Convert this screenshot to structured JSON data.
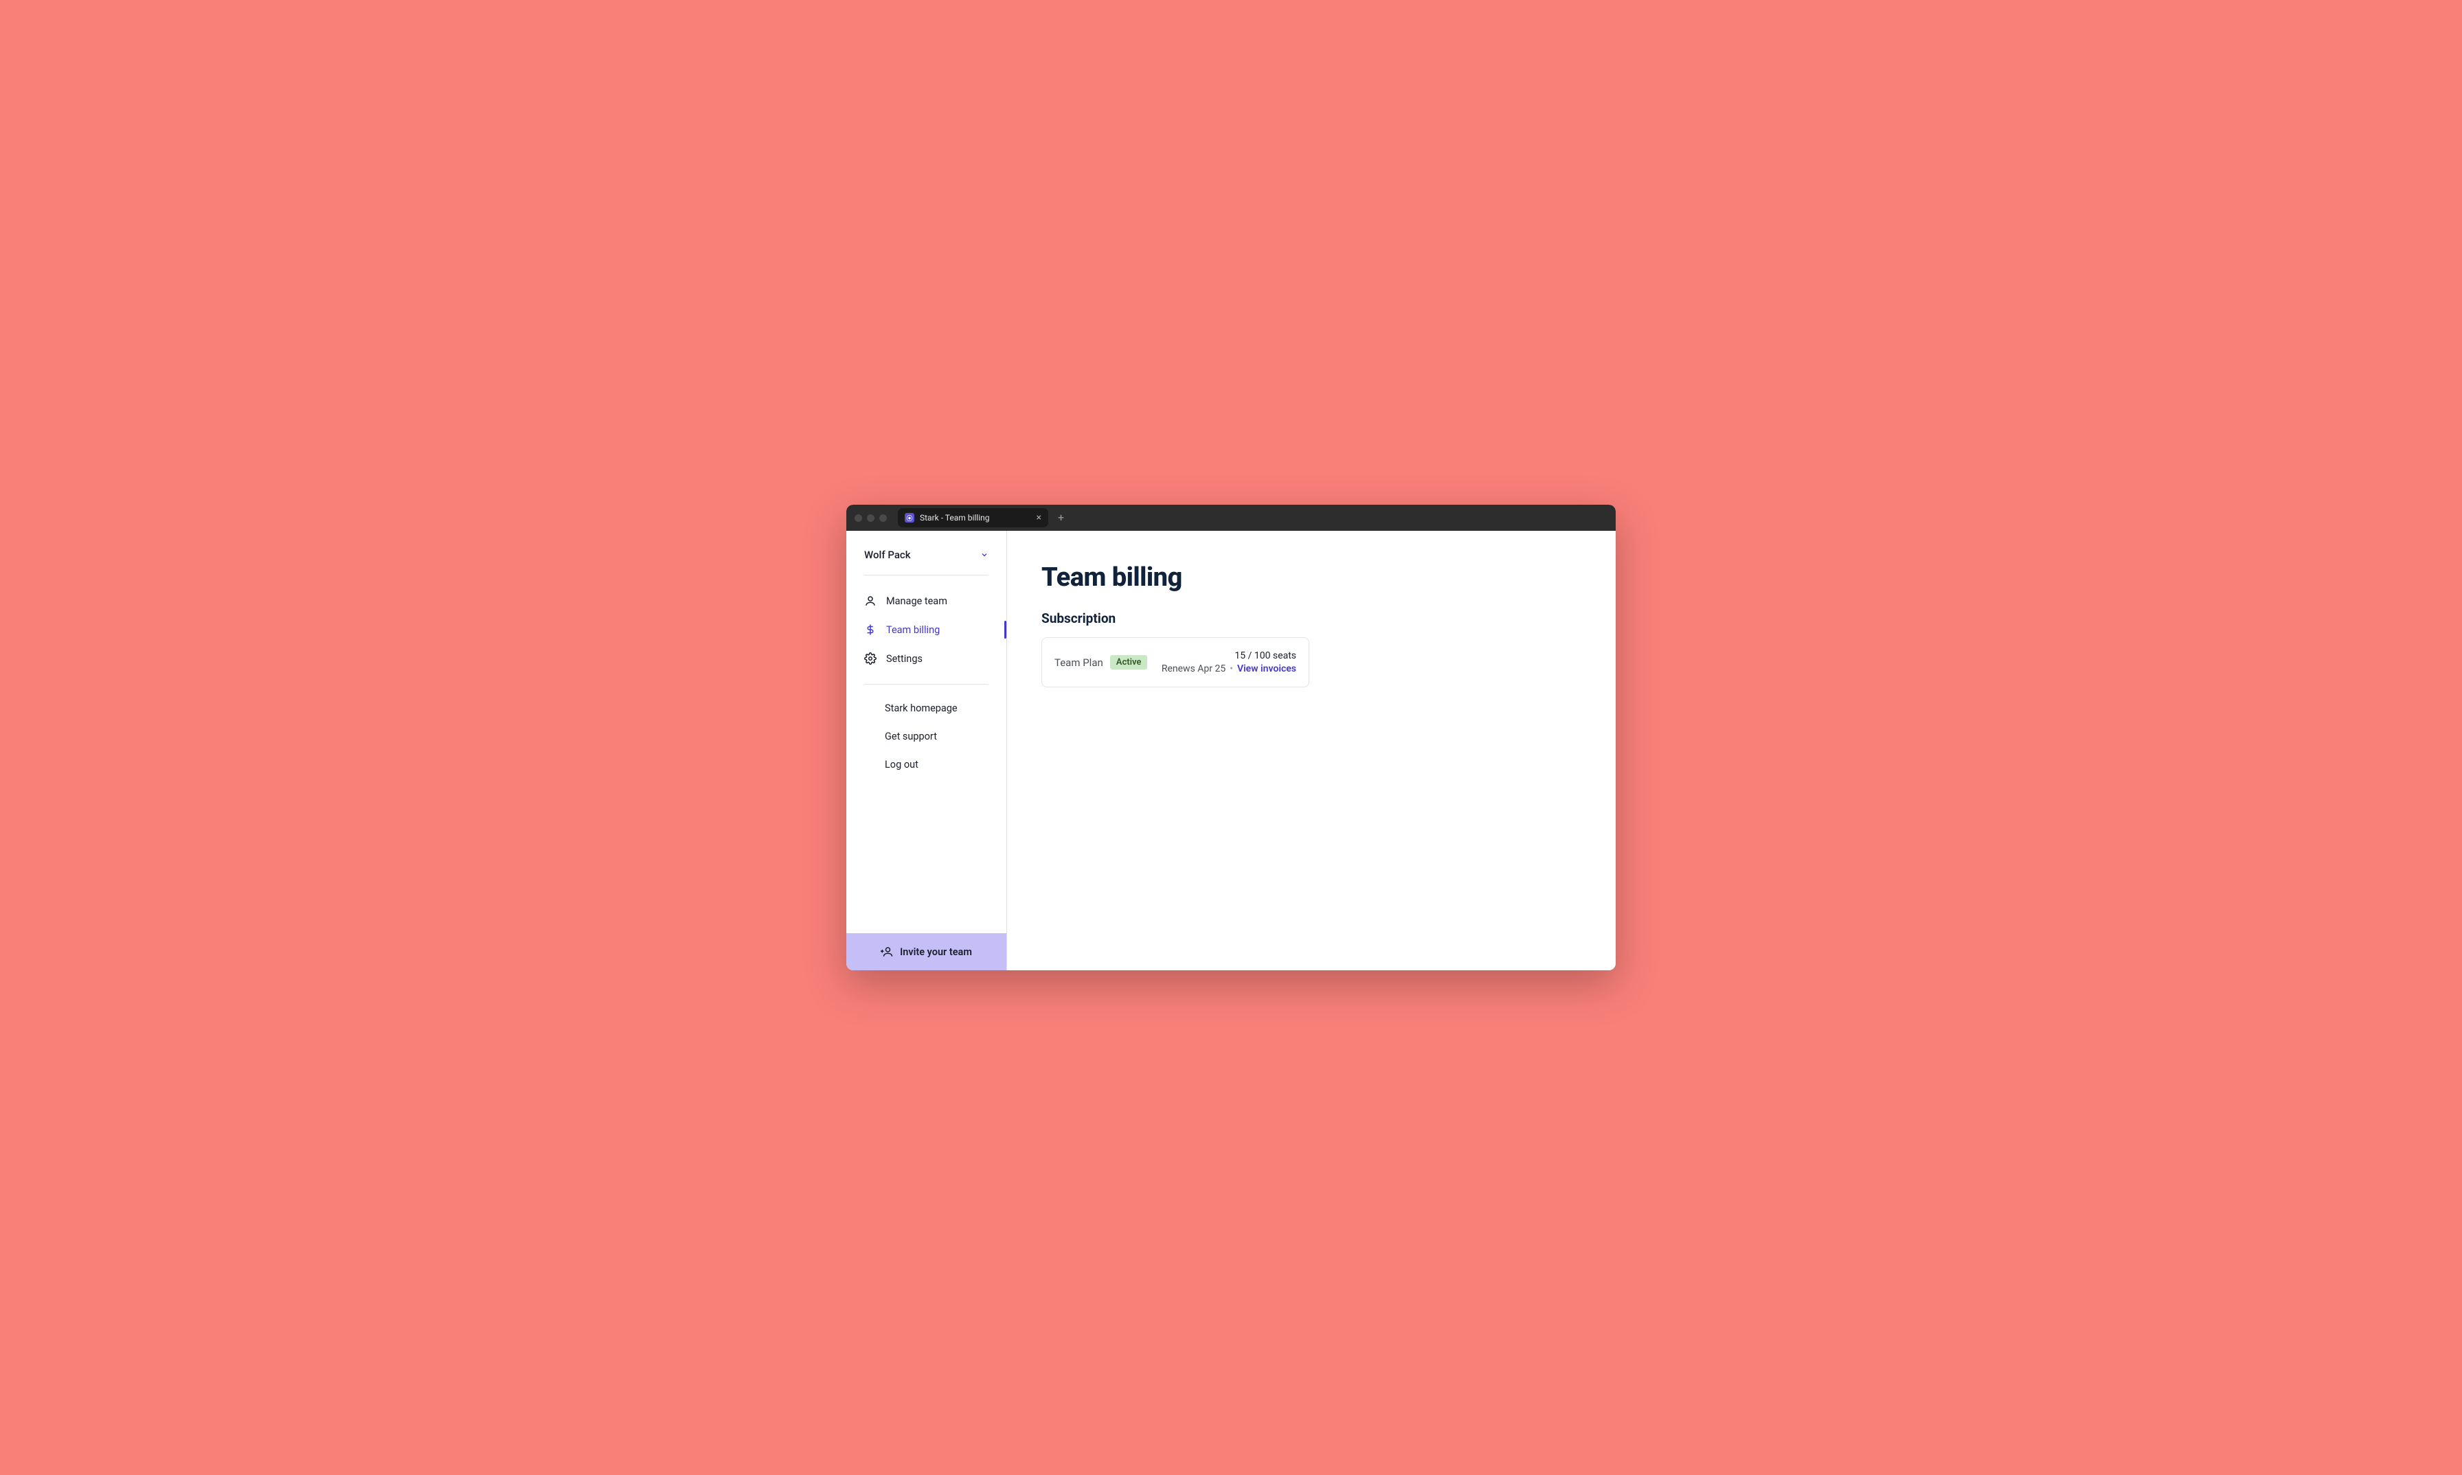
{
  "browser": {
    "tab_title": "Stark - Team billing"
  },
  "sidebar": {
    "team_name": "Wolf Pack",
    "nav": {
      "manage_team": "Manage team",
      "team_billing": "Team billing",
      "settings": "Settings"
    },
    "secondary": {
      "homepage": "Stark homepage",
      "support": "Get support",
      "logout": "Log out"
    },
    "invite_label": "Invite your team"
  },
  "main": {
    "title": "Team billing",
    "subscription_heading": "Subscription",
    "plan": {
      "name": "Team Plan",
      "status": "Active",
      "seats": "15 / 100 seats",
      "renewal": "Renews Apr 25",
      "invoices_link": "View invoices"
    }
  }
}
